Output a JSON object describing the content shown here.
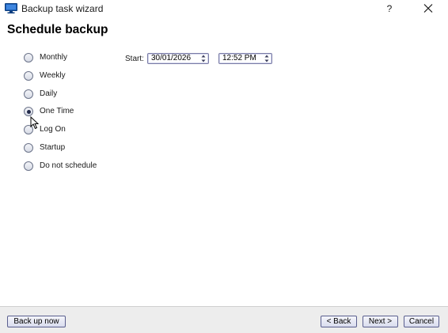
{
  "window": {
    "title": "Backup task wizard",
    "help_label": "?"
  },
  "page": {
    "title": "Schedule backup"
  },
  "schedule": {
    "options": [
      {
        "label": "Monthly",
        "selected": false
      },
      {
        "label": "Weekly",
        "selected": false
      },
      {
        "label": "Daily",
        "selected": false
      },
      {
        "label": "One Time",
        "selected": true
      },
      {
        "label": "Log On",
        "selected": false
      },
      {
        "label": "Startup",
        "selected": false
      },
      {
        "label": "Do not schedule",
        "selected": false
      }
    ],
    "start_label": "Start:",
    "start_date": "30/01/2026",
    "start_time": "12:52 PM"
  },
  "footer": {
    "backup_now_label": "Back up now",
    "back_label": "< Back",
    "next_label": "Next >",
    "cancel_label": "Cancel"
  },
  "colors": {
    "footer_background": "#ededed",
    "button_border": "#5a5f8e",
    "app_icon": "#1d5fb5"
  },
  "icons": {
    "app": "monitor-icon",
    "close": "close-icon",
    "spin": "spin-arrows-icon",
    "cursor": "mouse-cursor-icon"
  }
}
